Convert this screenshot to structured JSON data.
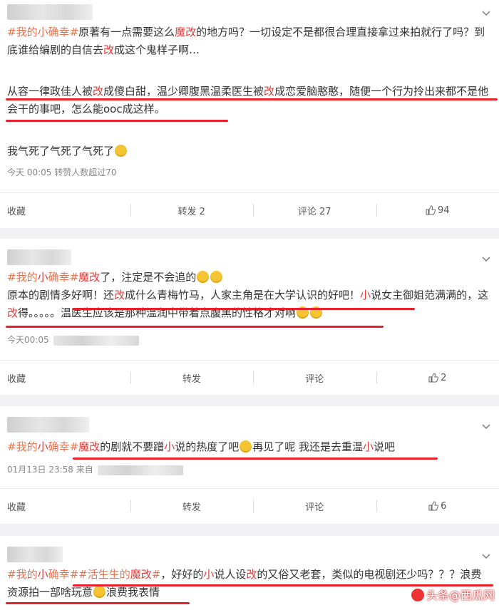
{
  "posts": [
    {
      "tag1": "#我的小确幸#",
      "seg1": "原著有一点需要这么",
      "red1": "魔改",
      "seg2": "的地方吗？一切设定不是都很合理直接拿过来拍就行了吗？到底谁给编剧的自信去",
      "red2": "改",
      "seg3": "成这个鬼样子啊…",
      "p2a": "从容一律政佳人被",
      "p2red1": "改",
      "p2b": "成傻白甜，温少卿腹黑温柔医生被",
      "p2red2": "改",
      "p2c": "成恋爱脑憨憨，随便一个行为拎出来都不是他会干的事吧，怎么能ooc成这样。",
      "p3": "我气死了气死了气死了",
      "meta": "今天 00:05  转赞人数超过70",
      "actions": [
        "收藏",
        "转发 2",
        "评论 27",
        "94"
      ]
    },
    {
      "tag1": "#我的",
      "tagred": "小",
      "tag2": "确幸#",
      "red1": "魔改",
      "seg1": "了，注定是不会追的",
      "seg2": "原本的剧情多好啊！还",
      "red2": "改",
      "seg3": "成什么青梅竹马，人家主角是在大学认识的好吧！",
      "red3": "小",
      "seg4": "说女主御姐范满满的，这",
      "red4": "改",
      "seg5": "得。。。。。温医生应该是那种温润中带着点腹黑的性格才对啊",
      "meta": "今天00:05",
      "actions": [
        "收藏",
        "转发",
        "评论",
        "2"
      ]
    },
    {
      "tag1": "#我的",
      "tagred": "小",
      "tag2": "确幸#",
      "red1": "魔改",
      "seg1": "的剧就不要蹭",
      "red2": "小",
      "seg2": "说的热度了吧",
      "seg3": "再见了呢 我还是去重温",
      "red3": "小",
      "seg4": "说吧",
      "meta": "01月13日 23:58  来自",
      "actions": [
        "收藏",
        "转发",
        "评论",
        "6"
      ]
    },
    {
      "tag1": "#我的",
      "tagred": "小",
      "tag2": "确幸#",
      "tag3": "#活生生的",
      "red1": "魔改",
      "tag3end": "#",
      "seg1": "，好好的",
      "red2": "小",
      "seg2": "说人设",
      "red3": "改",
      "seg3": "的又俗又老套，类似的电视剧还少吗？？？浪费资源拍一部啥玩意",
      "seg4": "浪费我表情"
    }
  ],
  "watermark": "头条@西瓜网",
  "colors": {
    "topic": "#eb7350",
    "highlight": "#e43a3a",
    "underline": "#e8202a"
  }
}
